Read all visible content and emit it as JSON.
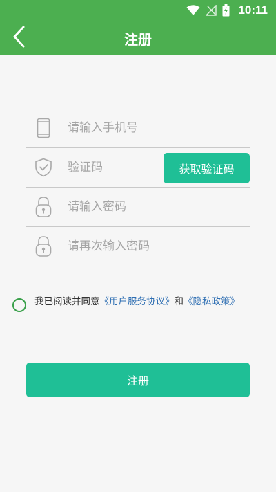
{
  "status_bar": {
    "time": "10:11",
    "icons": [
      "wifi-icon",
      "signal-off-icon",
      "battery-charging-icon"
    ]
  },
  "header": {
    "title": "注册",
    "back_icon": "chevron-left-icon"
  },
  "form": {
    "phone": {
      "placeholder": "请输入手机号",
      "value": "",
      "icon": "phone-icon"
    },
    "code": {
      "placeholder": "验证码",
      "value": "",
      "icon": "shield-check-icon",
      "button_label": "获取验证码"
    },
    "password": {
      "placeholder": "请输入密码",
      "value": "",
      "icon": "lock-icon"
    },
    "password_confirm": {
      "placeholder": "请再次输入密码",
      "value": "",
      "icon": "lock-icon"
    }
  },
  "agreement": {
    "checked": false,
    "prefix": "我已阅读并同意",
    "user_agreement": "《用户服务协议》",
    "conjunction": "和",
    "privacy_policy": "《隐私政策》"
  },
  "submit": {
    "label": "注册"
  },
  "colors": {
    "header": "#4caf50",
    "accent": "#1fbf96",
    "link": "#2f6fb3",
    "radio": "#3aa04b",
    "background": "#f6f6f6"
  }
}
